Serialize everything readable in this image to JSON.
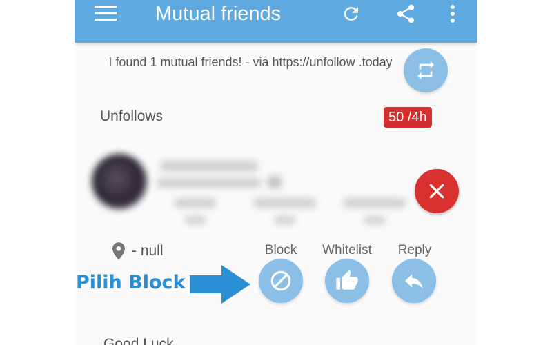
{
  "appbar": {
    "title": "Mutual friends",
    "icons": [
      "menu-icon",
      "refresh-icon",
      "share-icon",
      "more-vert-icon"
    ]
  },
  "share_text": "I found 1 mutual friends! -  via https://unfollow .today",
  "unfollows": {
    "label": "Unfollows",
    "limit": "50 /4h"
  },
  "profile": {
    "blurred": true
  },
  "location": {
    "text": "- null"
  },
  "actions": {
    "block": "Block",
    "whitelist": "Whitelist",
    "reply": "Reply"
  },
  "footer": {
    "text": "Good Luck"
  },
  "annotation": {
    "text": "Pilih Block"
  },
  "colors": {
    "appbar": "#5ea9e0",
    "fab": "#8bbfe6",
    "remove": "#d93030",
    "badge": "#d32f2f",
    "annotation": "#2b8fd6"
  }
}
